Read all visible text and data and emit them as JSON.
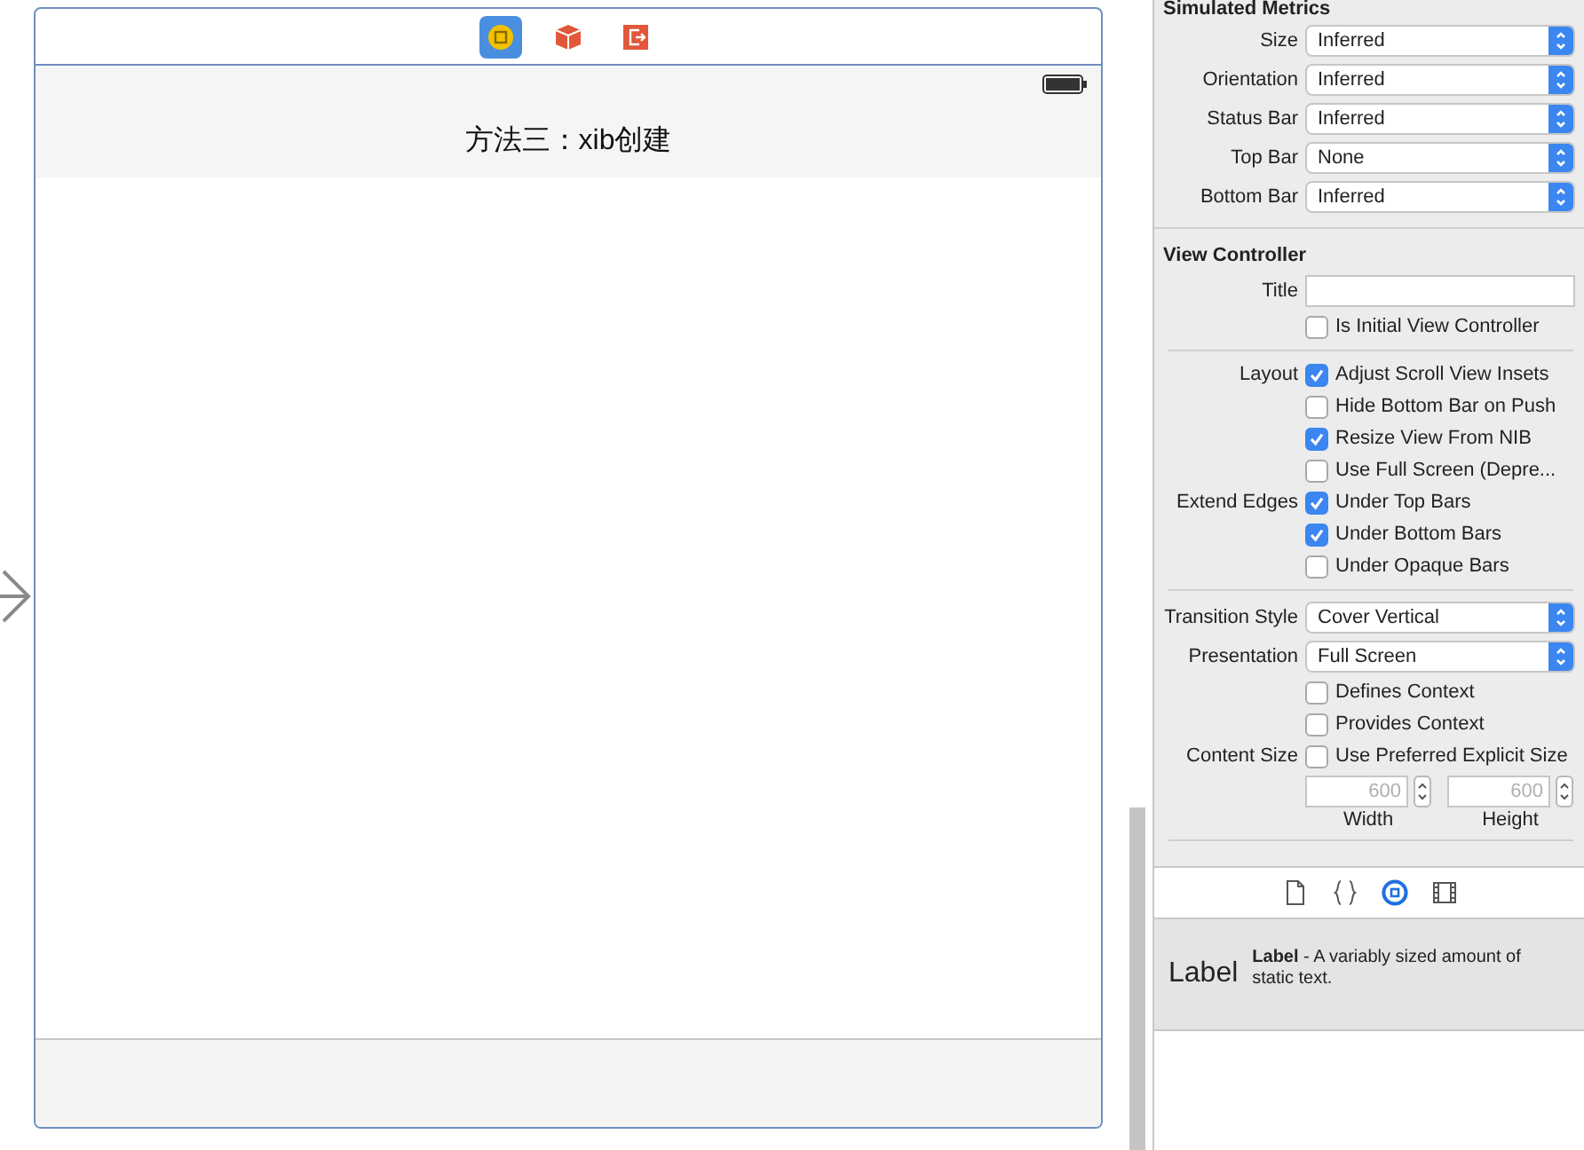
{
  "scene": {
    "navigation_bar": {
      "title": "方法三：xib创建"
    },
    "dock": [
      {
        "kind": "controller",
        "selected": true
      },
      {
        "kind": "responder",
        "selected": false
      },
      {
        "kind": "exit",
        "selected": false
      }
    ]
  },
  "inspector": {
    "simulated_metrics": {
      "title": "Simulated Metrics",
      "rows": [
        {
          "label": "Size",
          "value": "Inferred"
        },
        {
          "label": "Orientation",
          "value": "Inferred"
        },
        {
          "label": "Status Bar",
          "value": "Inferred"
        },
        {
          "label": "Top Bar",
          "value": "None"
        },
        {
          "label": "Bottom Bar",
          "value": "Inferred"
        }
      ]
    },
    "view_controller": {
      "title": "View Controller",
      "title_field": {
        "label": "Title"
      },
      "initial": {
        "label": "Is Initial View Controller",
        "checked": false
      },
      "groups": [
        {
          "label": "Layout",
          "items": [
            {
              "label": "Adjust Scroll View Insets",
              "checked": true
            },
            {
              "label": "Hide Bottom Bar on Push",
              "checked": false
            },
            {
              "label": "Resize View From NIB",
              "checked": true
            },
            {
              "label": "Use Full Screen (Depre...",
              "checked": false
            }
          ]
        },
        {
          "label": "Extend Edges",
          "items": [
            {
              "label": "Under Top Bars",
              "checked": true
            },
            {
              "label": "Under Bottom Bars",
              "checked": true
            },
            {
              "label": "Under Opaque Bars",
              "checked": false
            }
          ]
        }
      ],
      "popups": [
        {
          "label": "Transition Style",
          "value": "Cover Vertical"
        },
        {
          "label": "Presentation",
          "value": "Full Screen"
        }
      ],
      "context": [
        {
          "label": "Defines Context",
          "checked": false
        },
        {
          "label": "Provides Context",
          "checked": false
        }
      ],
      "content_size": {
        "label": "Content Size",
        "checkbox": {
          "label": "Use Preferred Explicit Size",
          "checked": false
        },
        "fields": [
          {
            "placeholder": "600",
            "caption": "Width"
          },
          {
            "placeholder": "600",
            "caption": "Height"
          }
        ]
      }
    }
  },
  "library": {
    "tabs": [
      {
        "kind": "file",
        "selected": false
      },
      {
        "kind": "braces",
        "selected": false
      },
      {
        "kind": "object",
        "selected": true
      },
      {
        "kind": "media",
        "selected": false
      }
    ],
    "items": [
      {
        "preview": "Label",
        "description": "**Label** - A variably sized amount of static text."
      }
    ]
  }
}
